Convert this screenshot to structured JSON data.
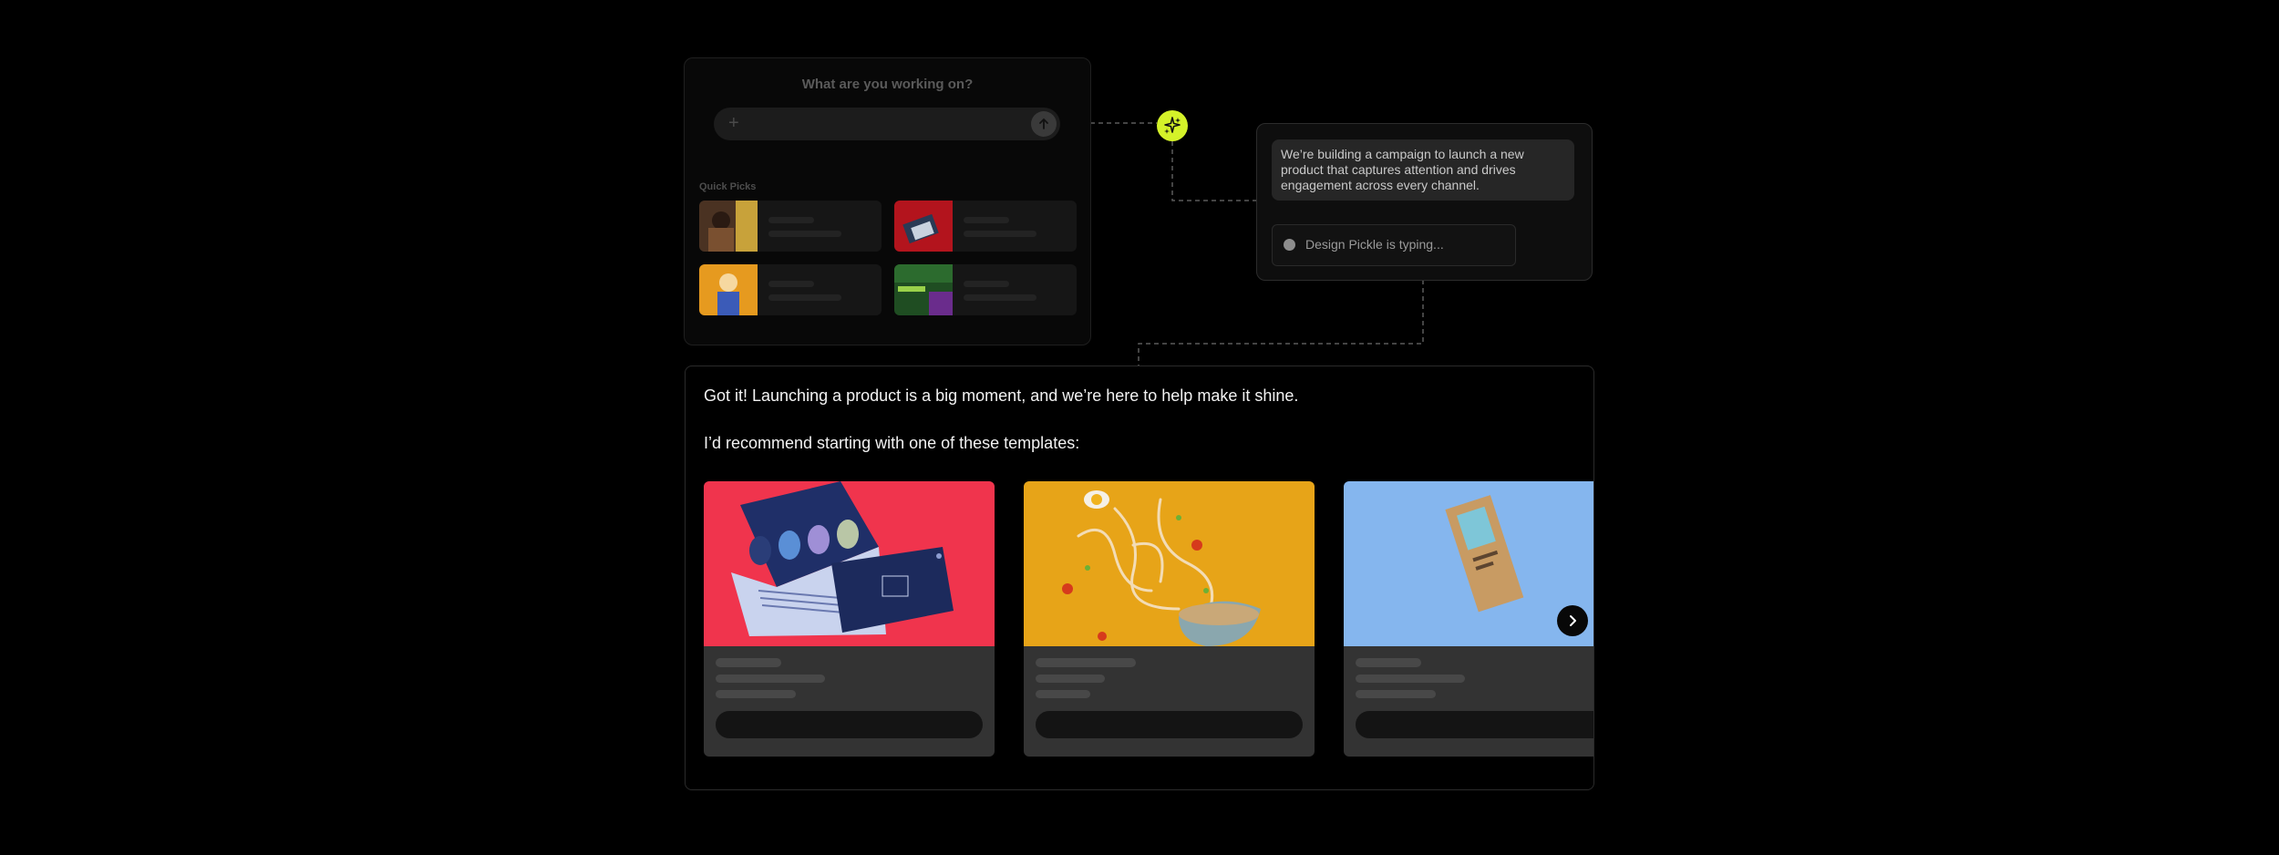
{
  "prompt_panel": {
    "title": "What are you working on?",
    "plus_glyph": "+",
    "quick_picks_label": "Quick Picks",
    "quick_picks": [
      {
        "thumb_color": "#6a4a2e",
        "accent": "#c8a23a",
        "icon": "photo-thumbnail"
      },
      {
        "thumb_color": "#b3141d",
        "accent": "#2a3a55",
        "icon": "photo-thumbnail"
      },
      {
        "thumb_color": "#e69a1f",
        "accent": "#f6d8a0",
        "icon": "photo-thumbnail"
      },
      {
        "thumb_color": "#2c6b2e",
        "accent": "#6a2c8c",
        "icon": "photo-thumbnail"
      }
    ]
  },
  "star": {
    "icon": "sparkle-icon",
    "color": "#d4f229"
  },
  "chat": {
    "user_message": "We’re building a campaign to launch a new product that captures attention and drives engagement across every channel.",
    "typing_text": "Design Pickle is typing..."
  },
  "response": {
    "line1": "Got it! Launching a product is a big moment, and we’re here to help make it shine.",
    "line2": "I’d recommend starting with one of these templates:",
    "templates": [
      {
        "bg": "#f0344d",
        "subject": "guitar pick brochure"
      },
      {
        "bg": "#e7a418",
        "subject": "noodle bowl splash"
      },
      {
        "bg": "#85b6ee",
        "subject": "tea box package"
      }
    ],
    "next_icon": "chevron-right-icon"
  }
}
